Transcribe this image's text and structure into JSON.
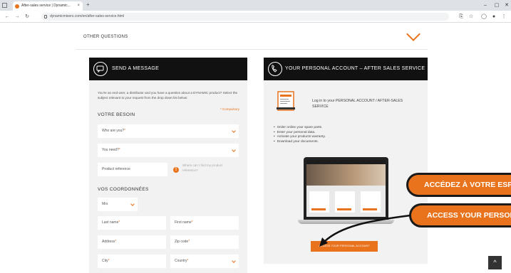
{
  "browser": {
    "tab_title": "After-sales service | Dynamic...",
    "tab_close": "×",
    "new_tab": "+",
    "url": "dynamicmixers.com/en/after-sales-service.html",
    "controls": {
      "minimize": "–",
      "maximize": "▢",
      "close": "✕"
    },
    "nav": {
      "back": "←",
      "forward": "→",
      "reload": "↻",
      "menu": "≡"
    }
  },
  "other_questions": {
    "label": "OTHER QUESTIONS"
  },
  "send_message": {
    "title": "SEND A MESSAGE",
    "intro": "You're an end-user, a distributor and you have a question about a DYNAMIC product? Select the subject relevant to your request from the drop down list below:",
    "mandatory_note": "* Compulsory",
    "section_besoin": "VOTRE BESOIN",
    "who_are_you": "Who are you?",
    "you_need": "You need?",
    "product_reference": "Product reference",
    "help_text": "Where can I find my product reference?",
    "help_icon": "!",
    "section_coordonnees": "VOS COORDONNÉES",
    "title_value": "Mrs",
    "last_name": "Last name",
    "first_name": "First name",
    "address": "Address",
    "zip_code": "Zip code",
    "city": "City",
    "country": "Country",
    "required_mark": "*"
  },
  "personal_account": {
    "title": "YOUR PERSONAL ACCOUNT – AFTER SALES SERVICE",
    "login_text": "Log in to your PERSONAL ACCOUNT / AFTER-SALES SERVICE",
    "bullets": [
      "Order online your spare parts.",
      "Enter your personal data.",
      "Activate your products warranty.",
      "Download your documents."
    ],
    "button_label": "ACCESS YOUR PERSONAL ACCOUNT"
  },
  "annotations": {
    "french_label": "ACCÉDEZ À VOTRE ESPACE",
    "english_label": "ACCESS YOUR PERSONAL"
  },
  "scroll_top_icon": "^",
  "colors": {
    "accent": "#e8731c",
    "header": "#111111",
    "panel": "#f2f2f2"
  }
}
